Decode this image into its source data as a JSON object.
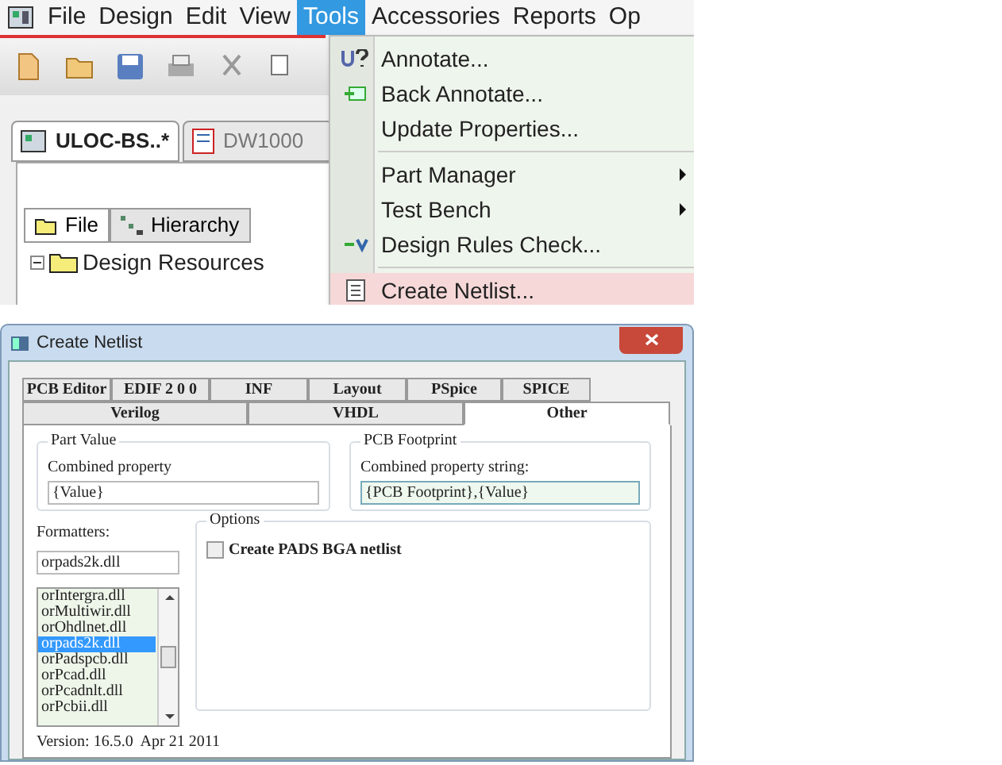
{
  "menu_bar": {
    "items": [
      {
        "label": "File",
        "selected": false
      },
      {
        "label": "Design",
        "selected": false
      },
      {
        "label": "Edit",
        "selected": false
      },
      {
        "label": "View",
        "selected": false
      },
      {
        "label": "Tools",
        "selected": true
      },
      {
        "label": "Accessories",
        "selected": false
      },
      {
        "label": "Reports",
        "selected": false
      },
      {
        "label": "Op",
        "selected": false
      }
    ]
  },
  "document_tabs": [
    {
      "label": "ULOC-BS..*",
      "selected": true
    },
    {
      "label": "DW1000",
      "selected": false
    }
  ],
  "panel_tabs": [
    {
      "label": "File",
      "selected": true
    },
    {
      "label": "Hierarchy",
      "selected": false
    }
  ],
  "tree": [
    {
      "label": "Design Resources",
      "expanded": true
    }
  ],
  "tools_menu": {
    "items": [
      {
        "kind": "item",
        "label": "Annotate...",
        "selected": false
      },
      {
        "kind": "item",
        "label": "Back Annotate...",
        "selected": false
      },
      {
        "kind": "item",
        "label": "Update Properties...",
        "selected": false
      },
      {
        "kind": "separator"
      },
      {
        "kind": "submenu",
        "label": "Part Manager",
        "selected": false
      },
      {
        "kind": "submenu",
        "label": "Test Bench",
        "selected": false
      },
      {
        "kind": "item",
        "label": "Design Rules Check...",
        "selected": false
      },
      {
        "kind": "separator"
      },
      {
        "kind": "item",
        "label": "Create Netlist...",
        "selected": true
      }
    ]
  },
  "dialog": {
    "title": "Create Netlist",
    "tab_rows": [
      [
        {
          "label": "PCB Editor",
          "selected": false
        },
        {
          "label": "EDIF 2 0 0",
          "selected": false
        },
        {
          "label": "INF",
          "selected": false
        },
        {
          "label": "Layout",
          "selected": false
        },
        {
          "label": "PSpice",
          "selected": false
        },
        {
          "label": "SPICE",
          "selected": false
        }
      ],
      [
        {
          "label": "Verilog",
          "selected": false
        },
        {
          "label": "VHDL",
          "selected": false
        },
        {
          "label": "Other",
          "selected": true
        }
      ]
    ],
    "part_value": {
      "legend": "Part Value",
      "label": "Combined property",
      "value": "{Value}"
    },
    "pcb_footprint": {
      "legend": "PCB Footprint",
      "label": "Combined property string:",
      "value": "{PCB Footprint},{Value}"
    },
    "formatters": {
      "label": "Formatters:",
      "value": "orpads2k.dll",
      "items": [
        {
          "label": "orIntergra.dll",
          "selected": false
        },
        {
          "label": "orMultiwir.dll",
          "selected": false
        },
        {
          "label": "orOhdlnet.dll",
          "selected": false
        },
        {
          "label": "orpads2k.dll",
          "selected": true
        },
        {
          "label": "orPadspcb.dll",
          "selected": false
        },
        {
          "label": "orPcad.dll",
          "selected": false
        },
        {
          "label": "orPcadnlt.dll",
          "selected": false
        },
        {
          "label": "orPcbii.dll",
          "selected": false
        }
      ]
    },
    "options": {
      "legend": "Options",
      "checkboxes": [
        {
          "label": "Create PADS BGA netlist",
          "checked": false
        }
      ]
    },
    "version": "Version: 16.5.0  Apr 21 2011"
  }
}
